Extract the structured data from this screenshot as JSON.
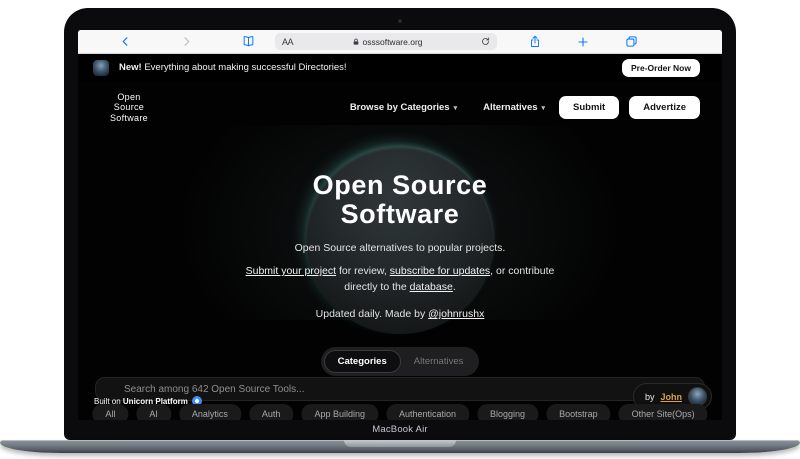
{
  "device": {
    "label": "MacBook Air"
  },
  "browser": {
    "reader_button": "AA",
    "address": "osssoftware.org"
  },
  "banner": {
    "badge": "New!",
    "message": " Everything about making successful Directories!",
    "cta": "Pre-Order Now"
  },
  "nav": {
    "logo": {
      "line1": "Open",
      "line2": "Source",
      "line3": "Software"
    },
    "items": [
      {
        "label": "Browse by Categories"
      },
      {
        "label": "Alternatives"
      }
    ],
    "submit": "Submit",
    "advertize": "Advertize"
  },
  "hero": {
    "title_line1": "Open Source",
    "title_line2": "Software",
    "tagline": "Open Source alternatives to popular projects.",
    "cta_line": {
      "link1": "Submit your project",
      "mid1": " for review, ",
      "link2": "subscribe for updates",
      "mid2": ", or contribute directly to the ",
      "link3": "database",
      "end": "."
    },
    "updated_prefix": "Updated daily. Made by ",
    "updated_link": "@johnrushx"
  },
  "tabs": [
    {
      "label": "Categories",
      "active": true
    },
    {
      "label": "Alternatives",
      "active": false
    }
  ],
  "search": {
    "placeholder": "Search among 642 Open Source Tools..."
  },
  "byline": {
    "prefix": "by",
    "name": "John"
  },
  "built_on": {
    "prefix": "Built on ",
    "brand": "Unicorn Platform"
  },
  "categories": [
    "All",
    "AI",
    "Analytics",
    "Auth",
    "App Building",
    "Authentication",
    "Blogging",
    "Bootstrap",
    "Other Site(Ops)"
  ],
  "colors": {
    "accent_blue": "#0a7aff",
    "gold": "#d9a050",
    "teal_glow": "#4ec0b4"
  }
}
